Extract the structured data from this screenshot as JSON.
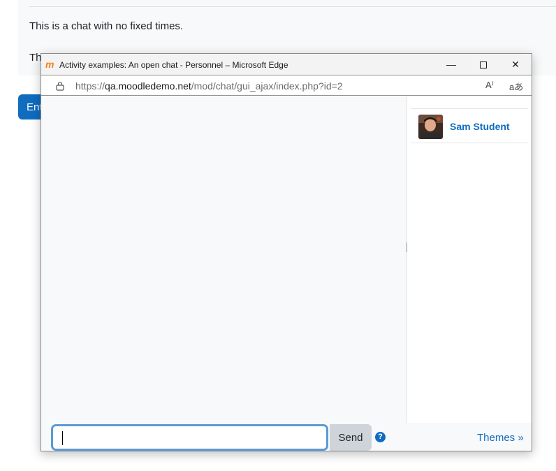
{
  "background": {
    "intro_text": "This is a chat with no fixed times.",
    "partial_text": "Th",
    "enter_button_partial": "Ent"
  },
  "window": {
    "title": "Activity examples: An open chat - Personnel – Microsoft Edge",
    "app_icon": "moodle-icon",
    "controls": {
      "minimize": "—",
      "close": "✕"
    }
  },
  "address_bar": {
    "url_prefix": "https://",
    "url_host": "qa.moodledemo.net",
    "url_path": "/mod/chat/gui_ajax/index.php?id=2",
    "read_aloud_label": "A⁾",
    "translate_label": "aあ"
  },
  "users": [
    {
      "name": "Sam Student",
      "avatar": "avatar-photo"
    }
  ],
  "input": {
    "value": "",
    "send_label": "Send",
    "help_label": "?",
    "themes_label": "Themes »"
  },
  "colors": {
    "accent": "#0f6cbf",
    "input_focus": "#5b9bd5",
    "moodle_orange": "#f98012"
  }
}
